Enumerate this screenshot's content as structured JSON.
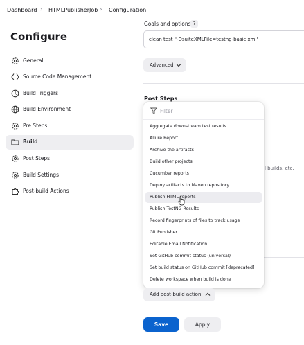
{
  "breadcrumb": {
    "items": [
      "Dashboard",
      "HTMLPublisherJob",
      "Configuration"
    ]
  },
  "page": {
    "title": "Configure"
  },
  "sidebar": {
    "items": [
      {
        "label": "General",
        "icon": "gear-icon"
      },
      {
        "label": "Source Code Management",
        "icon": "code-branch-icon"
      },
      {
        "label": "Build Triggers",
        "icon": "clock-icon"
      },
      {
        "label": "Build Environment",
        "icon": "globe-icon"
      },
      {
        "label": "Pre Steps",
        "icon": "gear-icon"
      },
      {
        "label": "Build",
        "icon": "folder-icon",
        "active": true
      },
      {
        "label": "Post Steps",
        "icon": "gear-icon"
      },
      {
        "label": "Build Settings",
        "icon": "gear-icon"
      },
      {
        "label": "Post-build Actions",
        "icon": "puzzle-icon"
      }
    ]
  },
  "main": {
    "goals_label": "Goals and options",
    "help_mark": "?",
    "goals_value": "clean test \"-DsuiteXMLFile=testng-basic.xml\"",
    "advanced_label": "Advanced",
    "post_steps_title": "Post Steps",
    "bg_fragment": "l builds, etc."
  },
  "dropdown": {
    "filter_placeholder": "Filter",
    "items": [
      "Aggregate downstream test results",
      "Allure Report",
      "Archive the artifacts",
      "Build other projects",
      "Cucumber reports",
      "Deploy artifacts to Maven repository",
      "Publish HTML reports",
      "Publish TestNG Results",
      "Record fingerprints of files to track usage",
      "Git Publisher",
      "Editable Email Notification",
      "Set GitHub commit status (universal)",
      "Set build status on GitHub commit [deprecated]",
      "Delete workspace when build is done"
    ],
    "hovered_item": "Publish HTML reports"
  },
  "actions": {
    "add_post_build_label": "Add post-build action",
    "save_label": "Save",
    "apply_label": "Apply"
  },
  "colors": {
    "primary": "#0b63ce",
    "active_bg": "#eeeef1",
    "text": "#1a1a1f"
  }
}
